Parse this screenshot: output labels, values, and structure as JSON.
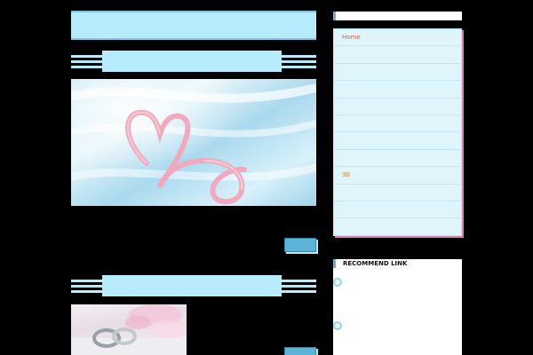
{
  "main": {
    "site_title": "",
    "articles": [
      {
        "heading": "",
        "more_label": ""
      },
      {
        "heading": "",
        "more_label": ""
      }
    ]
  },
  "sidebar": {
    "menu_heading": "",
    "menu_items": [
      {
        "label": "Home"
      },
      {
        "label": ""
      },
      {
        "label": ""
      },
      {
        "label": ""
      },
      {
        "label": ""
      },
      {
        "label": ""
      },
      {
        "label": ""
      },
      {
        "label": ""
      },
      {
        "label": "30"
      },
      {
        "label": ""
      },
      {
        "label": ""
      },
      {
        "label": ""
      }
    ],
    "recommend": {
      "heading": "RECOMMEND LINK",
      "links": [
        {
          "title": "",
          "highlight": "",
          "description": ""
        },
        {
          "title": "",
          "highlight": "",
          "description": ""
        }
      ]
    }
  },
  "colors": {
    "background": "#000000",
    "accent_light_blue": "#b6ecfd",
    "button_blue": "#5cb4d8",
    "menu_background": "#e0f4fb",
    "link_orange": "#c4761b",
    "shadow_pink": "#d67fae"
  },
  "icons": [
    "circle-icon"
  ]
}
